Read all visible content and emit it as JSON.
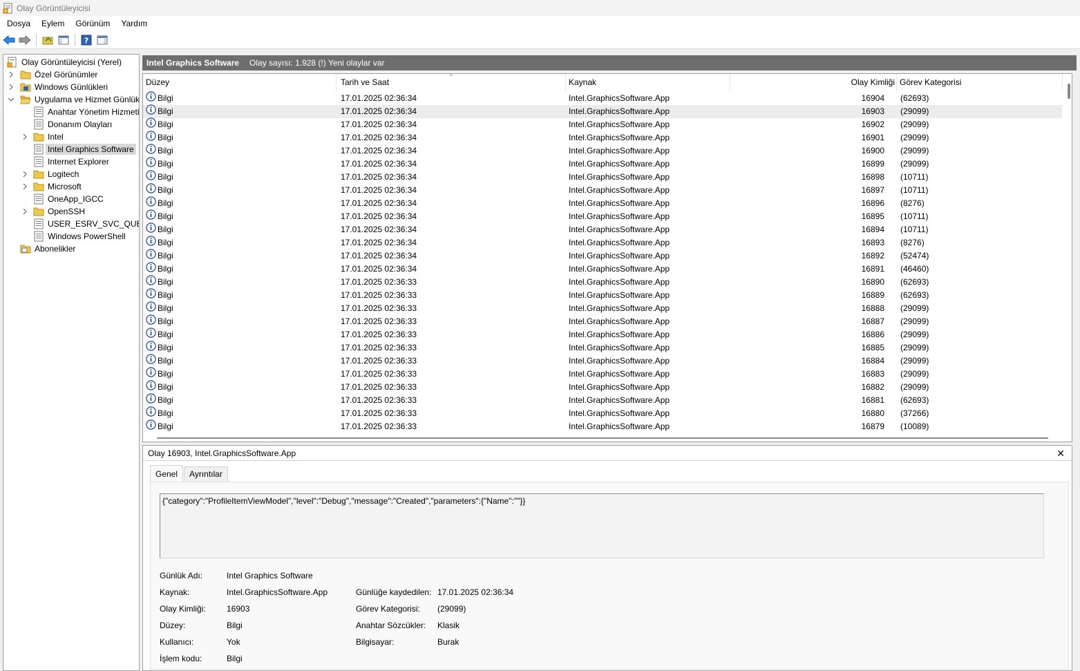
{
  "window": {
    "title": "Olay Görüntüleyicisi"
  },
  "menu": [
    "Dosya",
    "Eylem",
    "Görünüm",
    "Yardım"
  ],
  "toolbar": {
    "buttons": [
      "back-icon",
      "forward-icon",
      "up-folder-icon",
      "show-hide-tree-icon",
      "help-icon",
      "action-pane-icon"
    ]
  },
  "tree": {
    "root": "Olay Görüntüleyicisi (Yerel)",
    "custom_views": "Özel Görünümler",
    "windows_logs": "Windows Günlükleri",
    "app_service_logs": "Uygulama ve Hizmet Günlükleri",
    "children": [
      "Anahtar Yönetim Hizmeti",
      "Donanım Olayları",
      "Intel",
      "Intel Graphics Software",
      "Internet Explorer",
      "Logitech",
      "Microsoft",
      "OneApp_IGCC",
      "OpenSSH",
      "USER_ESRV_SVC_QUEENCREEK",
      "Windows PowerShell"
    ],
    "subscriptions": "Abonelikler"
  },
  "header": {
    "title": "Intel Graphics Software",
    "count": "Olay sayısı: 1.928 (!) Yeni olaylar var"
  },
  "columns": {
    "level": "Düzey",
    "date": "Tarih ve Saat",
    "source": "Kaynak",
    "id": "Olay Kimliği",
    "category": "Görev Kategorisi"
  },
  "events": [
    {
      "level": "Bilgi",
      "date": "17.01.2025 02:36:34",
      "source": "Intel.GraphicsSoftware.App",
      "id": "16904",
      "category": "(62693)"
    },
    {
      "level": "Bilgi",
      "date": "17.01.2025 02:36:34",
      "source": "Intel.GraphicsSoftware.App",
      "id": "16903",
      "category": "(29099)"
    },
    {
      "level": "Bilgi",
      "date": "17.01.2025 02:36:34",
      "source": "Intel.GraphicsSoftware.App",
      "id": "16902",
      "category": "(29099)"
    },
    {
      "level": "Bilgi",
      "date": "17.01.2025 02:36:34",
      "source": "Intel.GraphicsSoftware.App",
      "id": "16901",
      "category": "(29099)"
    },
    {
      "level": "Bilgi",
      "date": "17.01.2025 02:36:34",
      "source": "Intel.GraphicsSoftware.App",
      "id": "16900",
      "category": "(29099)"
    },
    {
      "level": "Bilgi",
      "date": "17.01.2025 02:36:34",
      "source": "Intel.GraphicsSoftware.App",
      "id": "16899",
      "category": "(29099)"
    },
    {
      "level": "Bilgi",
      "date": "17.01.2025 02:36:34",
      "source": "Intel.GraphicsSoftware.App",
      "id": "16898",
      "category": "(10711)"
    },
    {
      "level": "Bilgi",
      "date": "17.01.2025 02:36:34",
      "source": "Intel.GraphicsSoftware.App",
      "id": "16897",
      "category": "(10711)"
    },
    {
      "level": "Bilgi",
      "date": "17.01.2025 02:36:34",
      "source": "Intel.GraphicsSoftware.App",
      "id": "16896",
      "category": "(8276)"
    },
    {
      "level": "Bilgi",
      "date": "17.01.2025 02:36:34",
      "source": "Intel.GraphicsSoftware.App",
      "id": "16895",
      "category": "(10711)"
    },
    {
      "level": "Bilgi",
      "date": "17.01.2025 02:36:34",
      "source": "Intel.GraphicsSoftware.App",
      "id": "16894",
      "category": "(10711)"
    },
    {
      "level": "Bilgi",
      "date": "17.01.2025 02:36:34",
      "source": "Intel.GraphicsSoftware.App",
      "id": "16893",
      "category": "(8276)"
    },
    {
      "level": "Bilgi",
      "date": "17.01.2025 02:36:34",
      "source": "Intel.GraphicsSoftware.App",
      "id": "16892",
      "category": "(52474)"
    },
    {
      "level": "Bilgi",
      "date": "17.01.2025 02:36:34",
      "source": "Intel.GraphicsSoftware.App",
      "id": "16891",
      "category": "(46460)"
    },
    {
      "level": "Bilgi",
      "date": "17.01.2025 02:36:33",
      "source": "Intel.GraphicsSoftware.App",
      "id": "16890",
      "category": "(62693)"
    },
    {
      "level": "Bilgi",
      "date": "17.01.2025 02:36:33",
      "source": "Intel.GraphicsSoftware.App",
      "id": "16889",
      "category": "(62693)"
    },
    {
      "level": "Bilgi",
      "date": "17.01.2025 02:36:33",
      "source": "Intel.GraphicsSoftware.App",
      "id": "16888",
      "category": "(29099)"
    },
    {
      "level": "Bilgi",
      "date": "17.01.2025 02:36:33",
      "source": "Intel.GraphicsSoftware.App",
      "id": "16887",
      "category": "(29099)"
    },
    {
      "level": "Bilgi",
      "date": "17.01.2025 02:36:33",
      "source": "Intel.GraphicsSoftware.App",
      "id": "16886",
      "category": "(29099)"
    },
    {
      "level": "Bilgi",
      "date": "17.01.2025 02:36:33",
      "source": "Intel.GraphicsSoftware.App",
      "id": "16885",
      "category": "(29099)"
    },
    {
      "level": "Bilgi",
      "date": "17.01.2025 02:36:33",
      "source": "Intel.GraphicsSoftware.App",
      "id": "16884",
      "category": "(29099)"
    },
    {
      "level": "Bilgi",
      "date": "17.01.2025 02:36:33",
      "source": "Intel.GraphicsSoftware.App",
      "id": "16883",
      "category": "(29099)"
    },
    {
      "level": "Bilgi",
      "date": "17.01.2025 02:36:33",
      "source": "Intel.GraphicsSoftware.App",
      "id": "16882",
      "category": "(29099)"
    },
    {
      "level": "Bilgi",
      "date": "17.01.2025 02:36:33",
      "source": "Intel.GraphicsSoftware.App",
      "id": "16881",
      "category": "(62693)"
    },
    {
      "level": "Bilgi",
      "date": "17.01.2025 02:36:33",
      "source": "Intel.GraphicsSoftware.App",
      "id": "16880",
      "category": "(37266)"
    },
    {
      "level": "Bilgi",
      "date": "17.01.2025 02:36:33",
      "source": "Intel.GraphicsSoftware.App",
      "id": "16879",
      "category": "(10089)"
    }
  ],
  "detail": {
    "title": "Olay 16903, Intel.GraphicsSoftware.App",
    "tabs": [
      "Genel",
      "Ayrıntılar"
    ],
    "message": "{\"category\":\"ProfileItemViewModel\",\"level\":\"Debug\",\"message\":\"Created\",\"parameters\":{\"Name\":\"\"}}",
    "labels": {
      "log_name": "Günlük Adı:",
      "source": "Kaynak:",
      "event_id": "Olay Kimliği:",
      "level": "Düzey:",
      "user": "Kullanıcı:",
      "opcode": "İşlem kodu:",
      "logged": "Günlüğe kaydedilen:",
      "task_category": "Görev Kategorisi:",
      "keywords": "Anahtar Sözcükler:",
      "computer": "Bilgisayar:"
    },
    "values": {
      "log_name": "Intel Graphics Software",
      "source": "Intel.GraphicsSoftware.App",
      "event_id": "16903",
      "level": "Bilgi",
      "user": "Yok",
      "opcode": "Bilgi",
      "logged": "17.01.2025 02:36:34",
      "task_category": "(29099)",
      "keywords": "Klasik",
      "computer": "Burak"
    }
  },
  "colors": {
    "header_bar": "#6d6d6d",
    "selected_row": "#ececec",
    "info_icon": "#2b5797"
  }
}
